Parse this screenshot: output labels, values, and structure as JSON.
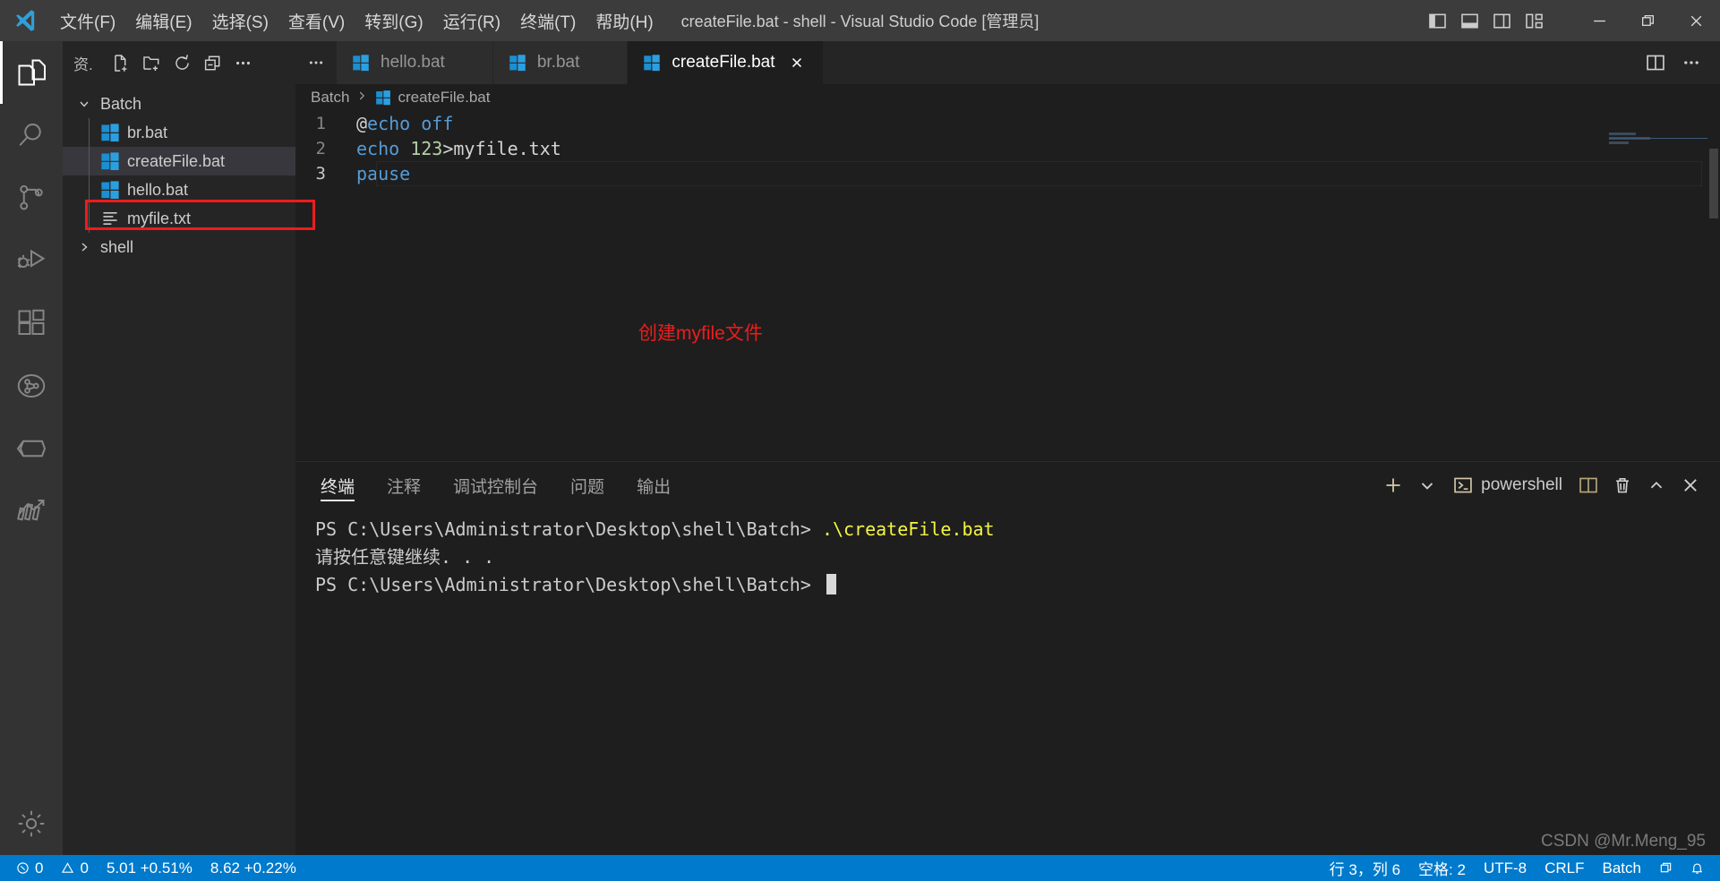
{
  "window": {
    "title": "createFile.bat - shell - Visual Studio Code [管理员]",
    "logo_icon": "vscode-logo-icon"
  },
  "menubar": {
    "items": [
      {
        "label": "文件(F)",
        "name": "menu-file"
      },
      {
        "label": "编辑(E)",
        "name": "menu-edit"
      },
      {
        "label": "选择(S)",
        "name": "menu-selection"
      },
      {
        "label": "查看(V)",
        "name": "menu-view"
      },
      {
        "label": "转到(G)",
        "name": "menu-go"
      },
      {
        "label": "运行(R)",
        "name": "menu-run"
      },
      {
        "label": "终端(T)",
        "name": "menu-terminal"
      },
      {
        "label": "帮助(H)",
        "name": "menu-help"
      }
    ]
  },
  "window_controls": {
    "toggle_primary_sidebar": "toggle-primary-sidebar-icon",
    "toggle_panel": "toggle-panel-icon",
    "toggle_secondary_sidebar": "toggle-secondary-sidebar-icon",
    "customize_layout": "customize-layout-icon",
    "minimize": "minimize-icon",
    "restore": "restore-icon",
    "close": "close-icon"
  },
  "activitybar": {
    "items": [
      {
        "name": "activity-explorer",
        "icon": "files-icon",
        "active": true
      },
      {
        "name": "activity-search",
        "icon": "search-icon",
        "active": false
      },
      {
        "name": "activity-source-control",
        "icon": "source-control-icon",
        "active": false
      },
      {
        "name": "activity-run-debug",
        "icon": "run-debug-icon",
        "active": false
      },
      {
        "name": "activity-extensions",
        "icon": "extensions-icon",
        "active": false
      },
      {
        "name": "activity-testing",
        "icon": "testing-beaker-icon",
        "active": false
      },
      {
        "name": "activity-docker",
        "icon": "docker-cube-icon",
        "active": false
      },
      {
        "name": "activity-chart",
        "icon": "chart-trend-icon",
        "active": false
      }
    ],
    "settings": {
      "name": "activity-manage-settings",
      "icon": "gear-icon"
    }
  },
  "sidebar": {
    "title": "资.",
    "actions": [
      {
        "name": "new-file-button",
        "icon": "new-file-icon"
      },
      {
        "name": "new-folder-button",
        "icon": "new-folder-icon"
      },
      {
        "name": "refresh-explorer-button",
        "icon": "refresh-icon"
      },
      {
        "name": "collapse-folders-button",
        "icon": "collapse-all-icon"
      },
      {
        "name": "explorer-more-actions-button",
        "icon": "ellipsis-icon"
      }
    ],
    "tree": [
      {
        "label": "Batch",
        "type": "folder",
        "expanded": true,
        "depth": 0,
        "icon": "chevron-down-icon",
        "selected": false,
        "annotated": false
      },
      {
        "label": "br.bat",
        "type": "bat",
        "depth": 1,
        "icon": "windows-bat-icon",
        "selected": false,
        "annotated": false
      },
      {
        "label": "createFile.bat",
        "type": "bat",
        "depth": 1,
        "icon": "windows-bat-icon",
        "selected": true,
        "annotated": false
      },
      {
        "label": "hello.bat",
        "type": "bat",
        "depth": 1,
        "icon": "windows-bat-icon",
        "selected": false,
        "annotated": false
      },
      {
        "label": "myfile.txt",
        "type": "txt",
        "depth": 1,
        "icon": "text-file-icon",
        "selected": false,
        "annotated": true
      },
      {
        "label": "shell",
        "type": "folder",
        "expanded": false,
        "depth": 0,
        "icon": "chevron-right-icon",
        "selected": false,
        "annotated": false
      }
    ]
  },
  "editor": {
    "tabs": [
      {
        "label": "hello.bat",
        "icon": "windows-bat-icon",
        "active": false
      },
      {
        "label": "br.bat",
        "icon": "windows-bat-icon",
        "active": false
      },
      {
        "label": "createFile.bat",
        "icon": "windows-bat-icon",
        "active": true
      }
    ],
    "tab_actions": [
      {
        "name": "split-editor-right-button",
        "icon": "split-editor-icon"
      },
      {
        "name": "editor-more-actions-button",
        "icon": "ellipsis-icon"
      }
    ],
    "breadcrumb": [
      {
        "label": "Batch",
        "icon": null
      },
      {
        "label": "createFile.bat",
        "icon": "windows-bat-icon"
      }
    ],
    "code": [
      {
        "num": "1",
        "tokens": [
          {
            "t": "@",
            "c": "plain"
          },
          {
            "t": "echo off",
            "c": "kw"
          }
        ]
      },
      {
        "num": "2",
        "tokens": [
          {
            "t": "echo ",
            "c": "kw"
          },
          {
            "t": "123",
            "c": "num"
          },
          {
            "t": ">myfile.txt",
            "c": "plain"
          }
        ]
      },
      {
        "num": "3",
        "tokens": [
          {
            "t": "pause",
            "c": "kw"
          }
        ],
        "current": true
      }
    ],
    "annotation": "创建myfile文件",
    "annotation_color": "#ee1c1c"
  },
  "panel": {
    "tabs": [
      {
        "label": "终端",
        "active": true,
        "name": "tab-terminal"
      },
      {
        "label": "注释",
        "active": false,
        "name": "tab-comments"
      },
      {
        "label": "调试控制台",
        "active": false,
        "name": "tab-debug-console"
      },
      {
        "label": "问题",
        "active": false,
        "name": "tab-problems"
      },
      {
        "label": "输出",
        "active": false,
        "name": "tab-output"
      }
    ],
    "actions": {
      "new_terminal": "plus-icon",
      "new_terminal_dropdown": "chevron-down-icon",
      "shell_name": "powershell",
      "shell_icon": "powershell-icon",
      "split_terminal": "split-terminal-icon",
      "kill_terminal": "trash-icon",
      "maximize_panel": "chevron-up-icon",
      "close_panel": "close-icon"
    },
    "terminal_lines": [
      {
        "prompt": "PS C:\\Users\\Administrator\\Desktop\\shell\\Batch> ",
        "command": ".\\createFile.bat"
      },
      {
        "prompt": "请按任意键继续. . .",
        "command": ""
      },
      {
        "prompt": "PS C:\\Users\\Administrator\\Desktop\\shell\\Batch> ",
        "command": "",
        "cursor": true
      }
    ]
  },
  "statusbar": {
    "left": [
      {
        "label": "0",
        "icon": "error-icon",
        "name": "status-errors"
      },
      {
        "label": "0",
        "icon": "warning-icon",
        "name": "status-warnings"
      },
      {
        "label": "5.01 +0.51%",
        "icon": null,
        "name": "status-ticker-1"
      },
      {
        "label": "8.62 +0.22%",
        "icon": null,
        "name": "status-ticker-2"
      }
    ],
    "right": [
      {
        "label": "行 3，列 6",
        "icon": null,
        "name": "status-cursor-position"
      },
      {
        "label": "空格: 2",
        "icon": null,
        "name": "status-indentation"
      },
      {
        "label": "UTF-8",
        "icon": null,
        "name": "status-encoding"
      },
      {
        "label": "CRLF",
        "icon": null,
        "name": "status-eol"
      },
      {
        "label": "Batch",
        "icon": null,
        "name": "status-language-mode"
      },
      {
        "label": "",
        "icon": "layout-icon",
        "name": "status-layout"
      },
      {
        "label": "",
        "icon": "bell-icon",
        "name": "status-notifications"
      }
    ]
  },
  "watermark": "CSDN @Mr.Meng_95",
  "colors": {
    "accent": "#007acc",
    "annotation_red": "#ee1c1c",
    "editor_bg": "#1e1e1e",
    "sidebar_bg": "#252526",
    "activitybar_bg": "#333333",
    "titlebar_bg": "#3c3c3c"
  }
}
